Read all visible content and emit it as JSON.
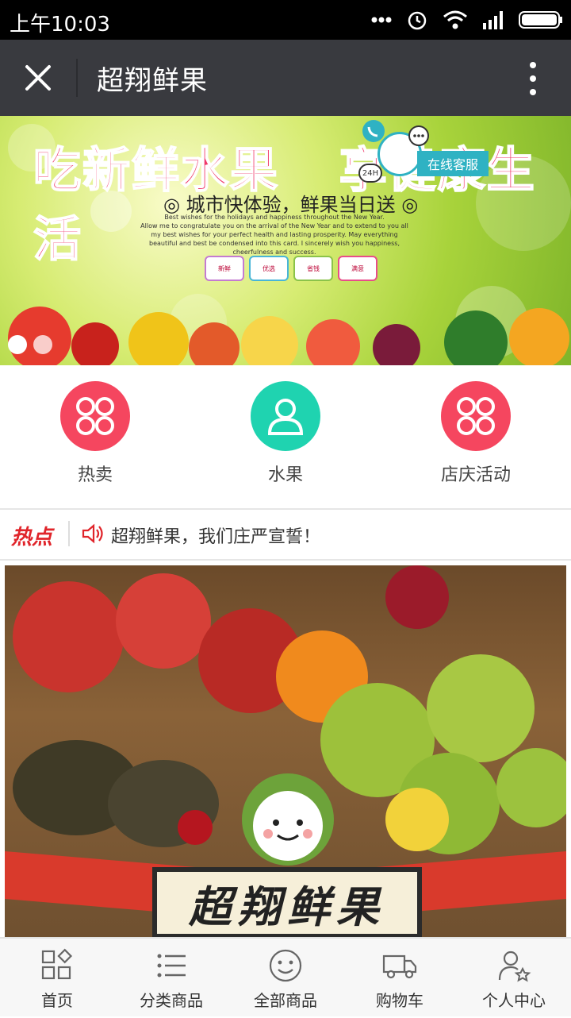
{
  "status_bar": {
    "time": "上午10:03"
  },
  "title_bar": {
    "title": "超翔鲜果"
  },
  "banner": {
    "headline_a": "吃新鲜水果",
    "headline_b": "享健康生活",
    "subline": "◎ 城市快体验，鲜果当日送 ◎",
    "english_1": "Best wishes for the holidays and happiness throughout the New Year.",
    "english_2": "Allow me to congratulate you on the arrival of the New Year and to extend to you all my best wishes for your perfect health and lasting prosperity. May everything beautiful and best be condensed into this card. I sincerely wish you happiness, cheerfulness and success.",
    "badges": [
      "新鲜",
      "优选",
      "省钱",
      "满意"
    ],
    "service_label": "在线客服",
    "service_24h": "24H",
    "slides": 2,
    "active_slide": 1
  },
  "quick_nav": [
    {
      "label": "热卖",
      "color": "#f5465f",
      "icon": "grid-icon"
    },
    {
      "label": "水果",
      "color": "#1fd3b0",
      "icon": "user-icon"
    },
    {
      "label": "店庆活动",
      "color": "#f5465f",
      "icon": "grid-icon"
    }
  ],
  "hot_news": {
    "tag": "热点",
    "text": "超翔鲜果，我们庄严宣誓！"
  },
  "promo": {
    "brand": "超翔鲜果"
  },
  "tab_bar": [
    {
      "label": "首页",
      "icon": "home-grid-icon"
    },
    {
      "label": "分类商品",
      "icon": "list-icon"
    },
    {
      "label": "全部商品",
      "icon": "smile-icon"
    },
    {
      "label": "购物车",
      "icon": "truck-icon"
    },
    {
      "label": "个人中心",
      "icon": "person-star-icon"
    }
  ]
}
